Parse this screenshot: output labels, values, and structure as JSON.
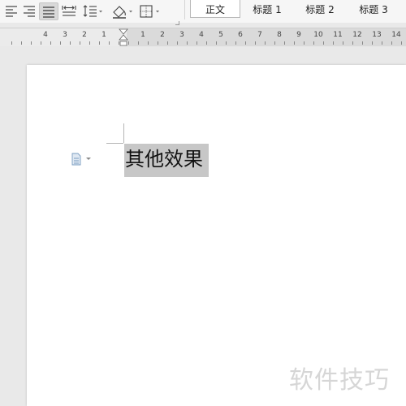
{
  "toolbar": {
    "buttons": [
      {
        "name": "align-left-icon",
        "active": false
      },
      {
        "name": "align-right-icon",
        "active": false
      },
      {
        "name": "justify-icon",
        "active": true
      },
      {
        "name": "distribute-icon",
        "active": false
      },
      {
        "name": "line-spacing-icon",
        "active": false
      },
      {
        "name": "shading-icon",
        "active": false
      },
      {
        "name": "borders-icon",
        "active": false
      }
    ]
  },
  "styles": {
    "items": [
      "正文",
      "标题 1",
      "标题 2",
      "标题 3"
    ],
    "selected": "正文"
  },
  "ruler": {
    "left_numbers": [
      "4",
      "3",
      "2",
      "1"
    ],
    "right_numbers": [
      "1",
      "2",
      "3",
      "4",
      "5",
      "6",
      "7",
      "8",
      "9",
      "10",
      "11",
      "12",
      "13",
      "14"
    ]
  },
  "document": {
    "selected_text": "其他效果"
  },
  "watermark": "软件技巧",
  "colors": {
    "selection": "#c7c7c7",
    "ruler_margin": "#dadada",
    "ruler_text_area": "#ebebeb",
    "page": "#ffffff"
  }
}
